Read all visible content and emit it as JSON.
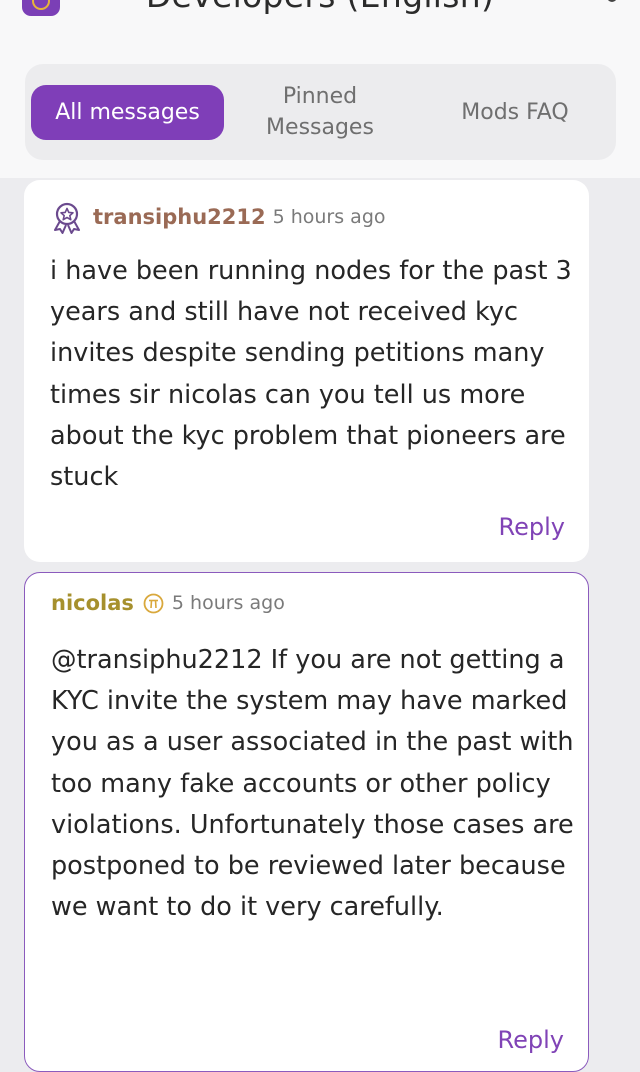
{
  "header": {
    "title": "Developers (English)"
  },
  "tabs": [
    {
      "label": "All messages"
    },
    {
      "label": "Pinned Messages"
    },
    {
      "label": "Mods FAQ"
    }
  ],
  "messages": [
    {
      "author": "transiphu2212",
      "time": "5 hours ago",
      "text": "i have been running nodes for the past 3 years and still have not received kyc invites despite sending petitions many times sir nicolas can you tell us more about the kyc problem that pioneers are stuck",
      "reply_label": "Reply",
      "badge_icon": "pioneer-badge-icon"
    },
    {
      "author": "nicolas",
      "time": "5 hours ago",
      "text": "@transiphu2212 If you are not getting a KYC invite the system may have marked you as a user associated in the past with too many fake accounts or other policy violations. Unfortunately those cases are postponed to be reviewed later because we want to do it very carefully.",
      "reply_label": "Reply",
      "badge_icon": "pi-coin-icon"
    }
  ],
  "colors": {
    "accent": "#7f3eb8",
    "reply": "#8043b6",
    "author_transiphu": "#9a6a55",
    "author_nicolas": "#a6902d"
  }
}
